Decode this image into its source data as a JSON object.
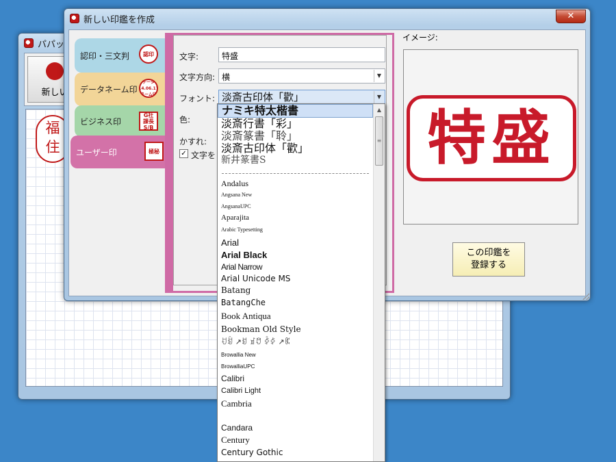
{
  "background_window": {
    "title": "パパッ",
    "new_button_label": "新しい",
    "seal_chars": [
      "福",
      "住"
    ]
  },
  "dialog": {
    "title": "新しい印鑑を作成",
    "close_label": "✕"
  },
  "tabs": [
    {
      "label": "認印・三文判",
      "stamp": "認印"
    },
    {
      "label": "データネーム印",
      "stamp": "データ 14.06.17 ネーム印"
    },
    {
      "label": "ビジネス印",
      "stamp": "G社 課長 S/B"
    },
    {
      "label": "ユーザー印",
      "stamp": "極秘"
    }
  ],
  "form": {
    "text_label": "文字:",
    "text_value": "特盛",
    "direction_label": "文字方向:",
    "direction_value": "横",
    "font_label": "フォント:",
    "font_value": "淡斎古印体「歡」",
    "color_label": "色:",
    "blur_label": "かすれ:",
    "checkbox_label": "文字を"
  },
  "preview": {
    "label": "イメージ:",
    "stamp_text": "特盛"
  },
  "register_button": "この印鑑を\n登録する",
  "font_list": {
    "favorites": [
      "ナミキ特太楷書",
      "淡斎行書「彩」",
      "淡斎篆書「聆」",
      "淡斎古印体「歡」",
      "新井篆書S"
    ],
    "fonts": [
      "Andalus",
      "Angsana New",
      "AngsanaUPC",
      "Aparajita",
      "Arabic Typesetting",
      "Arial",
      "Arial Black",
      "Arial Narrow",
      "Arial Unicode MS",
      "Batang",
      "BatangChe",
      "Book Antiqua",
      "Bookman Old Style",
      "ꀀꀁ ↗ꀂ ꀃꀄ ꀅꀆ ↗ꀇ",
      "Browallia New",
      "BrowalliaUPC",
      "Calibri",
      "Calibri Light",
      "Cambria",
      "",
      "Candara",
      "Century",
      "Century Gothic"
    ]
  }
}
